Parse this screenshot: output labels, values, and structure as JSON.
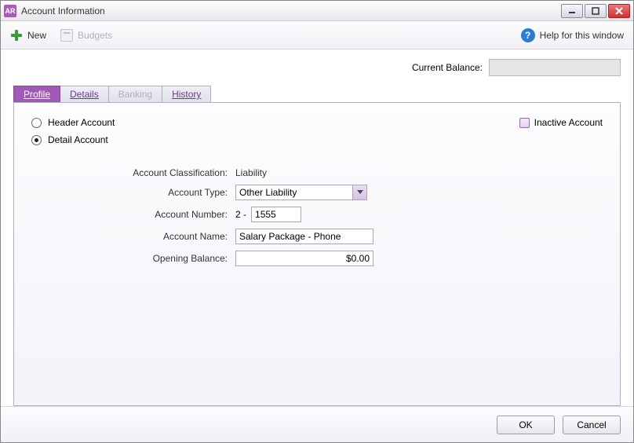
{
  "window": {
    "app_icon_text": "AR",
    "title": "Account Information"
  },
  "toolbar": {
    "new_label": "New",
    "budgets_label": "Budgets",
    "help_label": "Help for this window"
  },
  "balance": {
    "label": "Current Balance:"
  },
  "tabs": {
    "profile": "Profile",
    "details": "Details",
    "banking": "Banking",
    "history": "History"
  },
  "profile": {
    "header_radio": "Header Account",
    "detail_radio": "Detail Account",
    "inactive_label": "Inactive Account",
    "classification_label": "Account Classification:",
    "classification_value": "Liability",
    "type_label": "Account Type:",
    "type_value": "Other Liability",
    "number_label": "Account Number:",
    "number_prefix": "2 -",
    "number_value": "1555",
    "name_label": "Account Name:",
    "name_value": "Salary Package - Phone",
    "opening_label": "Opening Balance:",
    "opening_value": "$0.00"
  },
  "footer": {
    "ok": "OK",
    "cancel": "Cancel"
  }
}
